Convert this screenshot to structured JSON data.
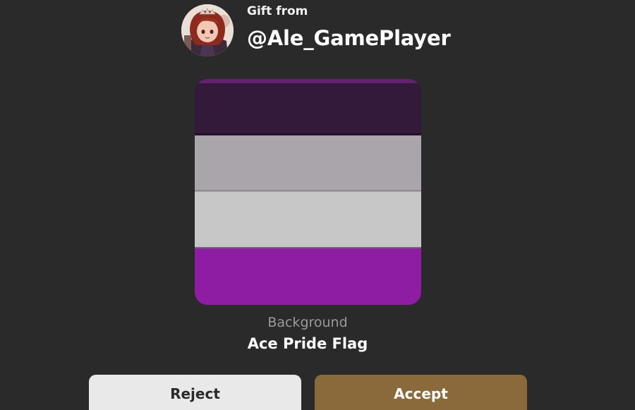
{
  "gift": {
    "label": "Gift from",
    "sender_username": "@Ale_GamePlayer",
    "avatar_icon": "user-avatar-anime-character"
  },
  "item": {
    "category": "Background",
    "name": "Ace Pride Flag",
    "stripe_colors": [
      "#331a3a",
      "#aaa5aa",
      "#c7c7c7",
      "#8e1da3"
    ]
  },
  "actions": {
    "reject_label": "Reject",
    "accept_label": "Accept"
  },
  "colors": {
    "background": "#2a2a2a",
    "accept_button": "#8a6a3a",
    "reject_button": "#e9e9e9"
  }
}
